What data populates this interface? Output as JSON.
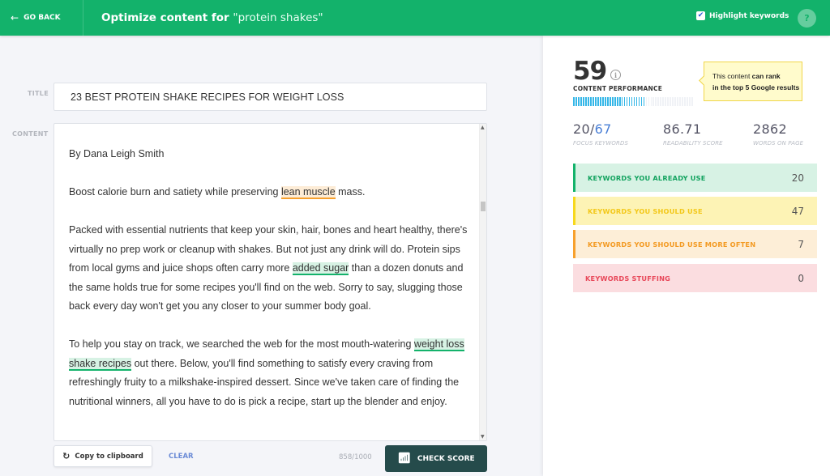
{
  "header": {
    "go_back": "GO BACK",
    "title_prefix": "Optimize content for",
    "title_keyword": "\"protein shakes\"",
    "highlight_label": "Highlight keywords",
    "highlight_checked": true,
    "help": "?"
  },
  "editor": {
    "title_label": "TITLE",
    "title_value": "23 BEST PROTEIN SHAKE RECIPES FOR WEIGHT LOSS",
    "content_label": "CONTENT",
    "content": {
      "byline": "By Dana Leigh Smith",
      "p1_before": "Boost calorie burn and satiety while preserving ",
      "p1_kw": "lean muscle",
      "p1_after": " mass.",
      "p2_before": "Packed with essential nutrients that keep your skin, hair, bones and heart healthy, there's virtually no prep work or cleanup with shakes. But not just any drink will do. Protein sips from local gyms and juice shops often carry more ",
      "p2_kw": "added sugar",
      "p2_after": " than a dozen donuts and the same holds true for some recipes you'll find on the web. Sorry to say, slugging those back every day won't get you any closer to your summer body goal.",
      "p3_before": "To help you stay on track, we searched the web for the most mouth-watering ",
      "p3_kw": "weight loss shake recipes",
      "p3_after": " out there. Below, you'll find something to satisfy every craving from refreshingly fruity to a milkshake-inspired dessert. Since we've taken care of finding the nutritional winners, all you have to do is pick a recipe, start up the blender and enjoy."
    },
    "copy_label": "Copy to clipboard",
    "clear_label": "CLEAR",
    "char_count": "858/1000",
    "check_label": "CHECK SCORE"
  },
  "panel": {
    "score": "59",
    "score_label": "CONTENT PERFORMANCE",
    "performance_fraction": 0.59,
    "tooltip_plain": "This content ",
    "tooltip_bold1": "can rank",
    "tooltip_bold2": "in the top 5 Google results",
    "stats": [
      {
        "value_a": "20/",
        "value_b": "67",
        "label": "FOCUS KEYWORDS"
      },
      {
        "value": "86.71",
        "label": "READABILITY SCORE"
      },
      {
        "value": "2862",
        "label": "WORDS ON PAGE"
      }
    ],
    "keyword_groups": [
      {
        "label": "KEYWORDS YOU ALREADY USE",
        "count": "20"
      },
      {
        "label": "KEYWORDS YOU SHOULD USE",
        "count": "47"
      },
      {
        "label": "KEYWORDS YOU SHOULD USE MORE OFTEN",
        "count": "7"
      },
      {
        "label": "KEYWORDS STUFFING",
        "count": "0"
      }
    ]
  },
  "colors": {
    "brand_green": "#13b26b",
    "check_button": "#254b4b",
    "performance_blue": "#35b7e8"
  }
}
